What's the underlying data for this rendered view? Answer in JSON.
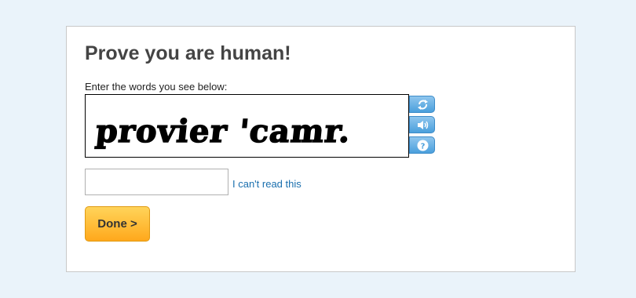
{
  "title": "Prove you are human!",
  "instructions": "Enter the words you see below:",
  "captcha": {
    "image_text": "provier 'camr.",
    "refresh_icon": "refresh-icon",
    "audio_icon": "audio-icon",
    "help_icon": "help-icon"
  },
  "answer_input": {
    "value": ""
  },
  "cant_read_link": "I can't read this",
  "done_button": "Done >",
  "colors": {
    "background": "#eaf3fa",
    "panel": "#ffffff",
    "link": "#1a6fae",
    "control_blue": "#4a9fdc",
    "done_orange": "#ffa81c"
  }
}
